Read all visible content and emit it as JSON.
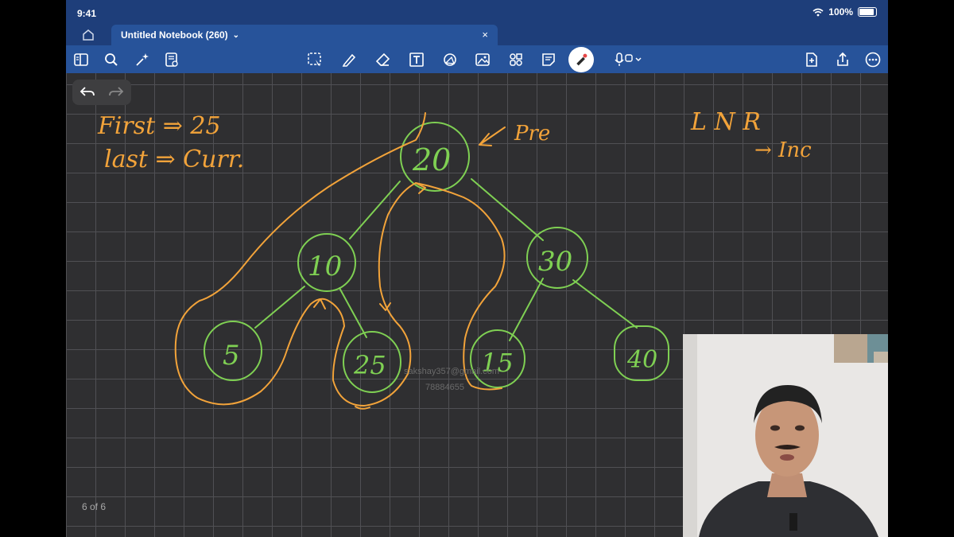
{
  "status": {
    "time": "9:41",
    "battery": "100%"
  },
  "tab": {
    "title": "Untitled Notebook (260)",
    "close_glyph": "×",
    "chevron_glyph": "⌄"
  },
  "toolbar": {
    "left_icons": [
      "sidebar-icon",
      "search-icon",
      "sparkle-icon",
      "notebook-icon"
    ],
    "center_icons": [
      "lasso-icon",
      "pen-icon",
      "eraser-icon",
      "textbox-icon",
      "shapes-icon",
      "image-icon",
      "elements-icon",
      "sticky-note-icon",
      "laser-pointer-icon"
    ],
    "right_icons": [
      "microphone-icon",
      "add-page-icon",
      "share-icon",
      "more-icon"
    ],
    "active_tool": "laser-pointer-icon"
  },
  "page_indicator": "6 of 6",
  "canvas": {
    "notes_left": [
      "First ⇒ 25",
      "last ⇒ Curr."
    ],
    "notes_right": [
      "L N R",
      "→ Inc"
    ],
    "pre_label": "Pre",
    "nodes": [
      "20",
      "10",
      "30",
      "5",
      "25",
      "15",
      "40"
    ],
    "watermark": [
      "sakshay357@gmail.com",
      "78884655"
    ]
  },
  "colors": {
    "ink_orange": "#f2a33a",
    "ink_green": "#7fd053",
    "toolbar_blue": "#27539a",
    "canvas_bg": "#2f2f31"
  }
}
